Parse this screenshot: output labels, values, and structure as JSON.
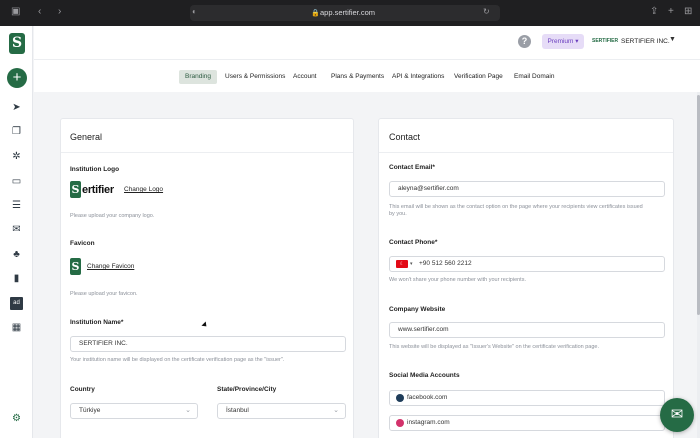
{
  "browser": {
    "url": "app.sertifier.com"
  },
  "header": {
    "help": "?",
    "premium": "Premium",
    "company": "SERTIFIER INC.",
    "mini_logo": "SERTIFIER"
  },
  "tabs": [
    "Branding",
    "Users & Permissions",
    "Account",
    "Plans & Payments",
    "API & Integrations",
    "Verification Page",
    "Email Domain"
  ],
  "general": {
    "title": "General",
    "logo_label": "Institution Logo",
    "brand_word": "ertifier",
    "brand_letter": "S",
    "change_logo": "Change Logo",
    "logo_help": "Please upload your company logo.",
    "favicon_label": "Favicon",
    "change_favicon": "Change Favicon",
    "favicon_help": "Please upload your favicon.",
    "name_label": "Institution Name*",
    "name_value": "SERTIFIER INC.",
    "name_help": "Your institution name will be displayed on the certificate verification page as the \"issuer\".",
    "country_label": "Country",
    "country_value": "Türkiye",
    "state_label": "State/Province/City",
    "state_value": "İstanbul"
  },
  "contact": {
    "title": "Contact",
    "email_label": "Contact Email*",
    "email_value": "aleyna@sertifier.com",
    "email_help_1": "This email will be shown as the contact option on the page where your recipients view certificates issued",
    "email_help_2": "by you.",
    "phone_label": "Contact Phone*",
    "phone_value": "+90 512 560 2212",
    "phone_help": "We won't share your phone number with your recipients.",
    "website_label": "Company Website",
    "website_value": "www.sertifier.com",
    "website_help": "This website will be displayed as \"Issuer's Website\" on the certificate verification page.",
    "social_label": "Social Media Accounts",
    "facebook": "facebook.com",
    "instagram": "instagram.com"
  },
  "colors": {
    "brand": "#256b45",
    "premium_bg": "#e6dcf7",
    "premium_text": "#6b3fbf"
  },
  "icons": [
    "sidebar-toggle-icon",
    "back-icon",
    "forward-icon",
    "shield-icon",
    "lock-icon",
    "reload-icon",
    "share-icon",
    "new-tab-icon",
    "tabs-icon",
    "plus-icon",
    "send-icon",
    "copy-icon",
    "gear-icon",
    "monitor-icon",
    "list-icon",
    "mail-icon",
    "users-icon",
    "bar-chart-icon",
    "ad-icon",
    "gift-icon",
    "settings-icon",
    "chat-icon"
  ]
}
